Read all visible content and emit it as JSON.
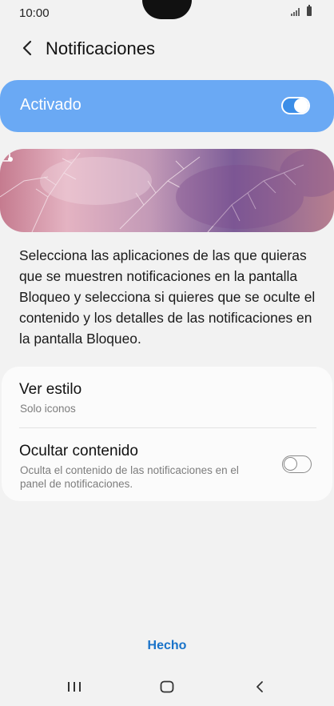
{
  "status_bar": {
    "time": "10:00"
  },
  "header": {
    "title": "Notificaciones"
  },
  "master_switch": {
    "label": "Activado",
    "state": "on",
    "accent_color": "#6aa9f4"
  },
  "description": "Selecciona las aplicaciones de las que quieras que se muestren notificaciones en la pantalla Bloqueo y selecciona si quieres que se oculte el contenido y los detalles de las notificaciones en la pantalla Bloqueo.",
  "options": [
    {
      "title": "Ver estilo",
      "subtitle": "Solo iconos"
    },
    {
      "title": "Ocultar contenido",
      "subtitle": "Oculta el contenido de las notificaciones en el panel de notificaciones.",
      "toggle_state": "off"
    }
  ],
  "footer": {
    "done_label": "Hecho"
  },
  "icons": {
    "back": "chevron-left-icon",
    "lock_notification": "notification-settings-icon",
    "nav_recent": "recent-apps-icon",
    "nav_home": "home-icon",
    "nav_back": "back-icon"
  }
}
